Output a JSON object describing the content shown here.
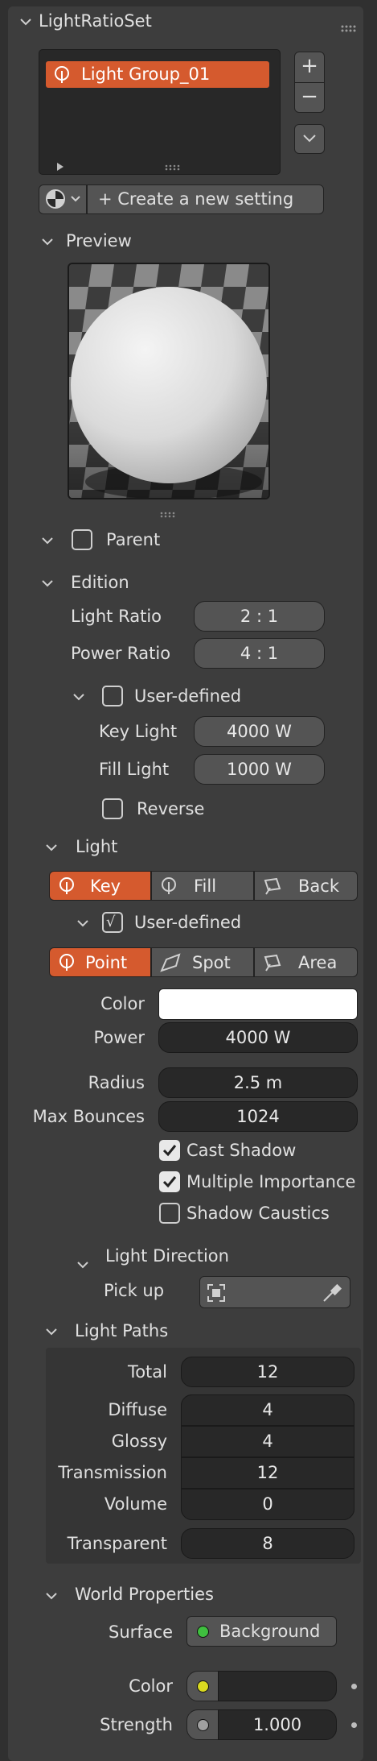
{
  "panel": {
    "title": "LightRatioSet"
  },
  "list": {
    "items": [
      {
        "label": "Light Group_01"
      }
    ],
    "add_button": "+",
    "remove_button": "−",
    "options_button": "v",
    "expand_icon": "triangle-right-icon",
    "resize_icon": "grip-icon"
  },
  "create_button": {
    "label": "+  Create a new setting"
  },
  "preview": {
    "header": "Preview"
  },
  "parent": {
    "label": "Parent",
    "checked": false
  },
  "edition": {
    "header": "Edition",
    "light_ratio_label": "Light Ratio",
    "light_ratio_value": "2 : 1",
    "power_ratio_label": "Power Ratio",
    "power_ratio_value": "4 : 1",
    "user_defined_label": "User-defined",
    "key_light_label": "Key Light",
    "key_light_value": "4000 W",
    "fill_light_label": "Fill Light",
    "fill_light_value": "1000 W",
    "reverse_label": "Reverse"
  },
  "light": {
    "header": "Light",
    "role_tabs": [
      "Key",
      "Fill",
      "Back"
    ],
    "role_active": "Key",
    "user_defined_label": "User-defined",
    "user_defined_mark": "√",
    "type_tabs": [
      "Point",
      "Spot",
      "Area"
    ],
    "type_active": "Point",
    "color_label": "Color",
    "color_value": "#ffffff",
    "power_label": "Power",
    "power_value": "4000 W",
    "radius_label": "Radius",
    "radius_value": "2.5 m",
    "max_bounces_label": "Max Bounces",
    "max_bounces_value": "1024",
    "cast_shadow_label": "Cast Shadow",
    "multiple_importance_label": "Multiple Importance",
    "shadow_caustics_label": "Shadow Caustics"
  },
  "light_direction": {
    "header": "Light Direction",
    "pick_up_label": "Pick up"
  },
  "light_paths": {
    "header": "Light Paths",
    "rows": [
      {
        "label": "Total",
        "value": "12"
      },
      {
        "label": "Diffuse",
        "value": "4"
      },
      {
        "label": "Glossy",
        "value": "4"
      },
      {
        "label": "Transmission",
        "value": "12"
      },
      {
        "label": "Volume",
        "value": "0"
      },
      {
        "label": "Transparent",
        "value": "8"
      }
    ]
  },
  "world": {
    "header": "World Properties",
    "surface_label": "Surface",
    "surface_value": "Background",
    "surface_dot_color": "#3fbf3f",
    "color_label": "Color",
    "color_dot_color": "#d9d920",
    "strength_label": "Strength",
    "strength_value": "1.000",
    "strength_dot_color": "#a0a0a0"
  },
  "colors": {
    "accent": "#d55a2e",
    "panel": "#3d3d3d",
    "background": "#303030"
  }
}
